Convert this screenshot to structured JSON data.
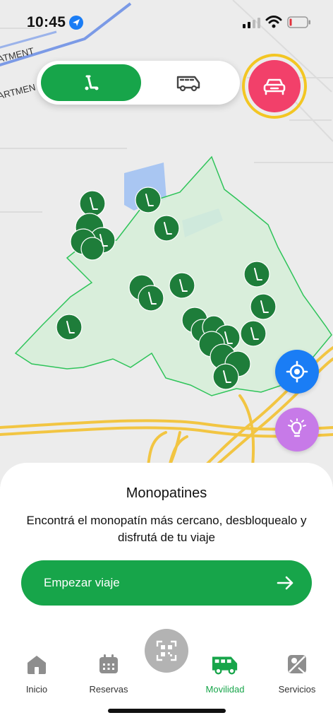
{
  "status_bar": {
    "time": "10:45"
  },
  "map": {
    "labels": [
      "ATMENT",
      "ARTMEN"
    ],
    "zone_color": "#2fc45a",
    "scooter_color": "#1e7d3a"
  },
  "mode_toggle": {
    "options": [
      {
        "name": "scooter",
        "icon": "scooter-icon",
        "selected": true
      },
      {
        "name": "van",
        "icon": "van-icon",
        "selected": false
      }
    ]
  },
  "colors": {
    "primary": "#17a54a",
    "car_button": "#f2406a",
    "car_ring": "#f3c623",
    "locate": "#1a7df5",
    "tips": "#c77ae8"
  },
  "sheet": {
    "title": "Monopatines",
    "description": "Encontrá el monopatín más cercano, desbloquealo y disfrutá de tu viaje",
    "cta_label": "Empezar viaje"
  },
  "tabbar": {
    "items": [
      {
        "label": "Inicio",
        "icon": "home-icon",
        "active": false
      },
      {
        "label": "Reservas",
        "icon": "calendar-icon",
        "active": false
      },
      {
        "label": "Movilidad",
        "icon": "van-icon",
        "active": true
      },
      {
        "label": "Servicios",
        "icon": "map-icon",
        "active": false
      }
    ],
    "center_icon": "qr-scan-icon"
  }
}
